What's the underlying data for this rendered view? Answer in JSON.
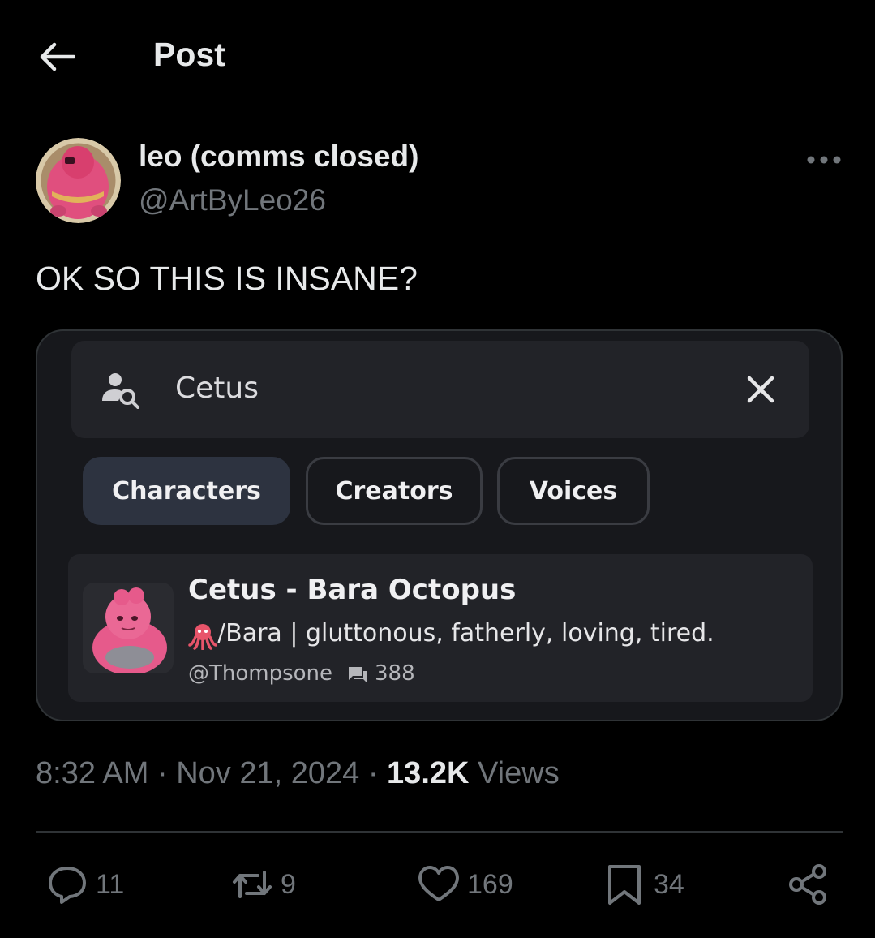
{
  "header": {
    "title": "Post"
  },
  "author": {
    "display_name": "leo (comms closed)",
    "handle": "@ArtByLeo26"
  },
  "post": {
    "text": "OK SO THIS IS INSANE?"
  },
  "embedded_screenshot": {
    "search": {
      "value": "Cetus"
    },
    "tabs": [
      {
        "label": "Characters",
        "active": true
      },
      {
        "label": "Creators",
        "active": false
      },
      {
        "label": "Voices",
        "active": false
      }
    ],
    "result": {
      "title": "Cetus - Bara Octopus",
      "description": "/Bara | gluttonous, fatherly, loving, tired.",
      "creator": "@Thompsone",
      "chat_count": "388"
    }
  },
  "meta": {
    "time": "8:32 AM",
    "separator": " · ",
    "date": "Nov 21, 2024",
    "views_count": "13.2K",
    "views_label": " Views"
  },
  "actions": {
    "replies": "11",
    "reposts": "9",
    "likes": "169",
    "bookmarks": "34"
  },
  "colors": {
    "background": "#000000",
    "text": "#e7e9ea",
    "muted": "#71767b",
    "card": "#17181c"
  }
}
